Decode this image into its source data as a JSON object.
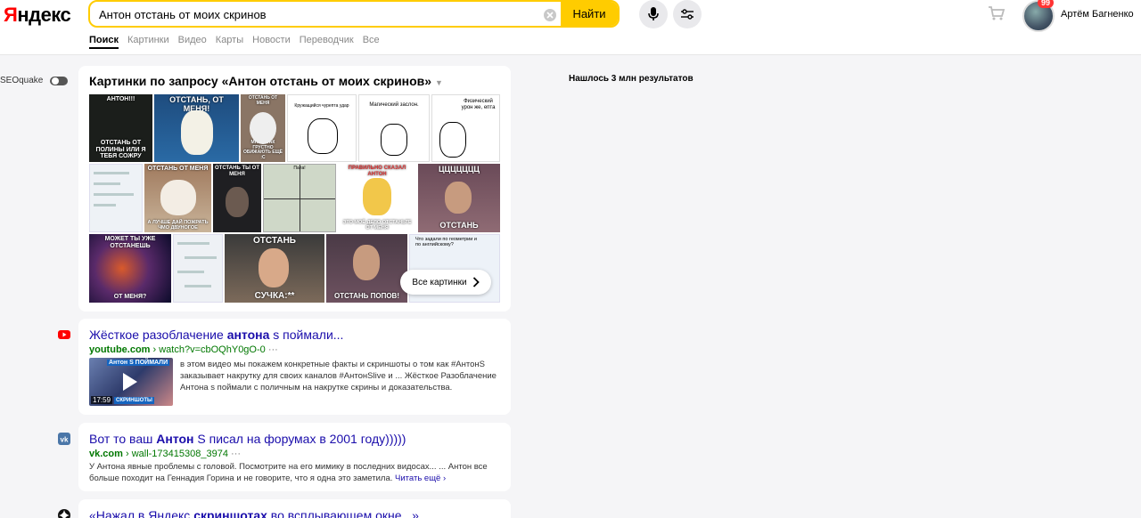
{
  "header": {
    "logo": "Яндекс",
    "search_value": "Антон отстань от моих скринов",
    "search_button": "Найти",
    "user_name": "Артём Багненко",
    "badge": "99"
  },
  "tabs": [
    {
      "label": "Поиск",
      "active": true
    },
    {
      "label": "Картинки"
    },
    {
      "label": "Видео"
    },
    {
      "label": "Карты"
    },
    {
      "label": "Новости"
    },
    {
      "label": "Переводчик"
    },
    {
      "label": "Все"
    }
  ],
  "sidebar": {
    "seoquake_label": "SEOquake"
  },
  "images_block": {
    "title": "Картинки по запросу «Антон отстань от моих скринов»",
    "all_images_label": "Все картинки",
    "thumbs": [
      {
        "top": "АНТОН!!!",
        "bottom": "ОТСТАНЬ ОТ ПОЛИНЫ ИЛИ Я ТЕБЯ СОЖРУ"
      },
      {
        "top": "ОТСТАНЬ, ОТ МЕНЯ!",
        "bottom": ""
      },
      {
        "top": "ОТСТАНЬ ОТ МЕНЯ",
        "bottom": "МНЕ И ТАК ГРУСТНО ОБИЖАЮТЬ ЕЩЁ :С"
      },
      {
        "top": "Кружащийся чурепта удар",
        "bottom": ""
      },
      {
        "top": "Магический заслон.",
        "bottom": ""
      },
      {
        "top": "Физический урон же, епта",
        "bottom": ""
      },
      {
        "top": "",
        "bottom": ""
      },
      {
        "top": "ОТСТАНЬ ОТ МЕНЯ",
        "bottom": "А ЛУЧШЕ ДАЙ ПОЖРАТЬ ЧМО ДВУНОГОЕ"
      },
      {
        "top": "ОТСТАНЬ ТЫ ОТ МЕНЯ",
        "bottom": ""
      },
      {
        "top": "Папа!",
        "bottom": ""
      },
      {
        "top": "ПРАВИЛЬНО СКАЗАЛ АНТОН",
        "bottom": "ЭТО МОЁ ДЕЛО ОТСТАНЬТЕ ОТ МЕНЯ"
      },
      {
        "top": "ЦЦЦЦЦЦЦ",
        "bottom": "ОТСТАНЬ"
      },
      {
        "top": "МОЖЕТ ТЫ УЖЕ ОТСТАНЕШЬ",
        "bottom": "ОТ МЕНЯ?"
      },
      {
        "top": "",
        "bottom": ""
      },
      {
        "top": "ОТСТАНЬ",
        "bottom": "СУЧКА:**"
      },
      {
        "top": "",
        "bottom": "ОТСТАНЬ ПОПОВ!"
      },
      {
        "top": "Что задали по геометрии и по английскому?",
        "bottom": ""
      }
    ]
  },
  "results_count": "Нашлось 3 млн результатов",
  "results": [
    {
      "title_pre": "Жёсткое разоблачение ",
      "title_bold": "антона",
      "title_post": " s поймали...",
      "domain": "youtube.com",
      "path": " › watch?v=cbOQhY0gO-0",
      "dots": " ···",
      "snippet": "в этом видео мы покажем конкретные факты и скриншоты о том как #АнтонS заказывает накрутку для своих каналов #АнтонSlive и ... Жёсткое Разоблачение Антона s поймали с поличным на накрутке скрины и доказательства.",
      "video_duration": "17:59",
      "video_tag": "СКРИНШОТЫ",
      "video_text": "Антон S ПОЙМАЛИ"
    },
    {
      "title_pre": "Вот то ваш ",
      "title_bold": "Антон",
      "title_post": " S писал на форумах в 2001 году)))))",
      "domain": "vk.com",
      "path": " › wall-173415308_3974",
      "dots": " ···",
      "snippet": "У Антона явные проблемы с головой. Посмотрите на его мимику в последних видосах... ... Антон все больше походит на Геннадия Горина и не говорите, что я одна это заметила.",
      "read_more": "Читать ещё ›"
    },
    {
      "title_pre": "«Нажал в Яндекс ",
      "title_bold": "скриншотах",
      "title_post": " во всплывающем окне...»"
    }
  ]
}
